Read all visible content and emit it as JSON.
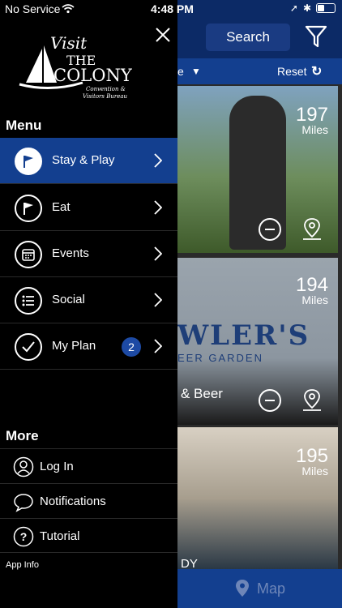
{
  "status_bar": {
    "carrier": "No Service",
    "time": "4:48 PM"
  },
  "background": {
    "search_label": "Search",
    "sort_label_partial": "e",
    "reset_label": "Reset",
    "cards": [
      {
        "distance": "197",
        "unit": "Miles",
        "caption": ""
      },
      {
        "distance": "194",
        "unit": "Miles",
        "banner": "WLER'S",
        "banner_sub": "EER GARDEN",
        "caption": "& Beer"
      },
      {
        "distance": "195",
        "unit": "Miles",
        "caption": "DY"
      }
    ],
    "map_label": "Map"
  },
  "drawer": {
    "logo_text": {
      "visit": "Visit",
      "the": "THE",
      "colony": "COLONY",
      "tagline1": "Convention &",
      "tagline2": "Visitors Bureau"
    },
    "menu_title": "Menu",
    "menu_items": [
      {
        "label": "Stay & Play",
        "icon": "flag-icon",
        "active": true
      },
      {
        "label": "Eat",
        "icon": "flag-icon",
        "active": false
      },
      {
        "label": "Events",
        "icon": "calendar-icon",
        "active": false
      },
      {
        "label": "Social",
        "icon": "list-icon",
        "active": false
      },
      {
        "label": "My Plan",
        "icon": "check-icon",
        "active": false,
        "badge": "2"
      }
    ],
    "more_title": "More",
    "more_items": [
      {
        "label": "Log In",
        "icon": "user-icon"
      },
      {
        "label": "Notifications",
        "icon": "chat-bubble-icon"
      },
      {
        "label": "Tutorial",
        "icon": "help-icon"
      }
    ],
    "app_info": "App Info"
  },
  "colors": {
    "accent": "#133f8f",
    "topbar": "#0c2a66",
    "badge": "#1d4aa4"
  }
}
